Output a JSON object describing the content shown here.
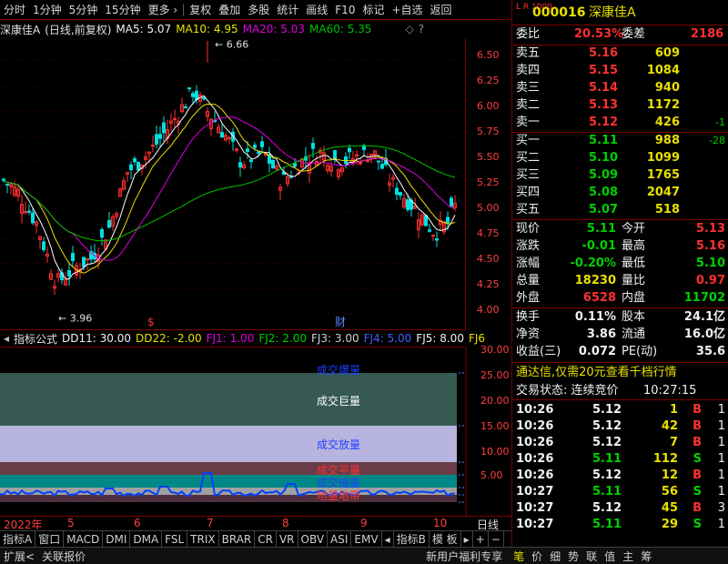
{
  "toolbar": {
    "items": [
      "分时",
      "1分钟",
      "5分钟",
      "15分钟",
      "更多 ›",
      "复权",
      "叠加",
      "多股",
      "统计",
      "画线",
      "F10",
      "标记",
      "+自选",
      "返回"
    ]
  },
  "header": {
    "stock_name": "深康佳A",
    "mode": "(日线,前复权)",
    "ma5": "MA5: 5.07",
    "ma10": "MA10: 4.95",
    "ma20": "MA20: 5.03",
    "ma60": "MA60: 5.35"
  },
  "price_axis": [
    "6.50",
    "6.25",
    "6.00",
    "5.75",
    "5.50",
    "5.25",
    "5.00",
    "4.75",
    "4.50",
    "4.25",
    "4.00"
  ],
  "price_annotations": {
    "high": "6.66",
    "low": "3.96",
    "event1": "$",
    "event2": "财"
  },
  "vol_header": {
    "title": "指标公式",
    "dd11": "DD11: 30.00",
    "dd22": "DD22: -2.00",
    "fj1": "FJ1: 1.00",
    "fj2": "FJ2: 2.00",
    "fj3": "FJ3: 3.00",
    "fj4": "FJ4: 5.00",
    "fj5": "FJ5: 8.00",
    "fj6": "FJ6"
  },
  "vol_axis": [
    "30.00",
    "25.00",
    "20.00",
    "15.00",
    "10.00",
    "5.00"
  ],
  "vol_bands": {
    "b1": "成交爆量",
    "b2": "成交巨量",
    "b3": "成交放量",
    "b4": "成交平量",
    "b5": "成交缩量",
    "b6": "地量地带"
  },
  "date_axis": {
    "year": "2022年",
    "m5": "5",
    "m6": "6",
    "m7": "7",
    "m8": "8",
    "m9": "9",
    "m10": "10",
    "period": "日线"
  },
  "tabs": [
    "指标A",
    "窗口",
    "MACD",
    "DMI",
    "DMA",
    "FSL",
    "TRIX",
    "BRAR",
    "CR",
    "VR",
    "OBV",
    "ASI",
    "EMV",
    "指标B",
    "模 板"
  ],
  "tab_icons": [
    "◂",
    "▸",
    "+",
    "−"
  ],
  "status": {
    "left1": "扩展<",
    "left2": "关联报价",
    "promo": "新用户福利专享",
    "tabs": [
      "笔",
      "价",
      "细",
      "势",
      "联",
      "值",
      "主",
      "筹"
    ]
  },
  "quote": {
    "logo": "L R 1000",
    "code": "000016",
    "name": "深康佳A",
    "weibi_label": "委比",
    "weibi": "20.53%",
    "weicha_label": "委差",
    "weicha": "2186",
    "asks": [
      {
        "label": "卖五",
        "price": "5.16",
        "vol": "609",
        "chg": ""
      },
      {
        "label": "卖四",
        "price": "5.15",
        "vol": "1084",
        "chg": ""
      },
      {
        "label": "卖三",
        "price": "5.14",
        "vol": "940",
        "chg": ""
      },
      {
        "label": "卖二",
        "price": "5.13",
        "vol": "1172",
        "chg": ""
      },
      {
        "label": "卖一",
        "price": "5.12",
        "vol": "426",
        "chg": "-1"
      }
    ],
    "bids": [
      {
        "label": "买一",
        "price": "5.11",
        "vol": "988",
        "chg": "-28"
      },
      {
        "label": "买二",
        "price": "5.10",
        "vol": "1099",
        "chg": ""
      },
      {
        "label": "买三",
        "price": "5.09",
        "vol": "1765",
        "chg": ""
      },
      {
        "label": "买四",
        "price": "5.08",
        "vol": "2047",
        "chg": ""
      },
      {
        "label": "买五",
        "price": "5.07",
        "vol": "518",
        "chg": ""
      }
    ],
    "stats1": [
      {
        "l": "现价",
        "v": "5.11",
        "l2": "今开",
        "v2": "5.13"
      },
      {
        "l": "涨跌",
        "v": "-0.01",
        "l2": "最高",
        "v2": "5.16"
      },
      {
        "l": "涨幅",
        "v": "-0.20%",
        "l2": "最低",
        "v2": "5.10"
      },
      {
        "l": "总量",
        "v": "18230",
        "l2": "量比",
        "v2": "0.97"
      },
      {
        "l": "外盘",
        "v": "6528",
        "l2": "内盘",
        "v2": "11702"
      }
    ],
    "stats2": [
      {
        "l": "换手",
        "v": "0.11%",
        "l2": "股本",
        "v2": "24.1亿"
      },
      {
        "l": "净资",
        "v": "3.86",
        "l2": "流通",
        "v2": "16.0亿"
      },
      {
        "l": "收益(三)",
        "v": "0.072",
        "l2": "PE(动)",
        "v2": "35.6"
      }
    ],
    "promo": "通达信,仅需20元查看千档行情",
    "trade_status": "交易状态: 连续竞价",
    "trade_time": "10:27:15",
    "ticks": [
      {
        "t": "10:26",
        "p": "5.12",
        "v": "1",
        "s": "B",
        "n": "1"
      },
      {
        "t": "10:26",
        "p": "5.12",
        "v": "42",
        "s": "B",
        "n": "1"
      },
      {
        "t": "10:26",
        "p": "5.12",
        "v": "7",
        "s": "B",
        "n": "1"
      },
      {
        "t": "10:26",
        "p": "5.11",
        "v": "112",
        "s": "S",
        "n": "1"
      },
      {
        "t": "10:26",
        "p": "5.12",
        "v": "12",
        "s": "B",
        "n": "1"
      },
      {
        "t": "10:27",
        "p": "5.11",
        "v": "56",
        "s": "S",
        "n": "1"
      },
      {
        "t": "10:27",
        "p": "5.12",
        "v": "45",
        "s": "B",
        "n": "3"
      },
      {
        "t": "10:27",
        "p": "5.11",
        "v": "29",
        "s": "S",
        "n": "1"
      }
    ]
  },
  "colors": {
    "up": "#ff3030",
    "down": "#00e0e0",
    "ma5": "#ffffff",
    "ma10": "#e8e000",
    "ma20": "#e000e0",
    "ma60": "#00c000",
    "frame": "#7a0000"
  }
}
